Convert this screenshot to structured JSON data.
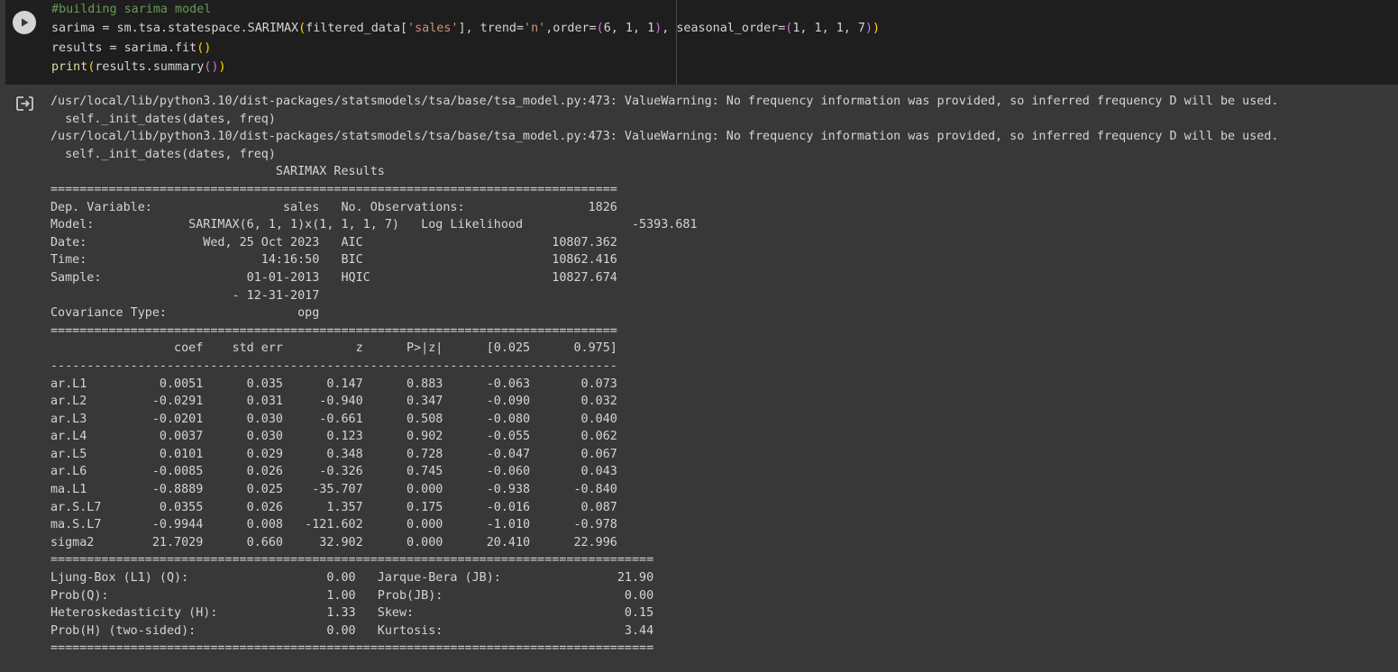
{
  "cell": {
    "run_icon": "play-icon",
    "code": {
      "line1": "#building sarima model",
      "line2_a": "sarima = sm.tsa.statespace.SARIMAX",
      "line2_b": "filtered_data[",
      "line2_c": "'sales'",
      "line2_d": "], trend=",
      "line2_e": "'n'",
      "line2_f": ",order=",
      "line2_g": "6, 1, 1",
      "line2_h": ", seasonal_order=",
      "line2_i": "1, 1, 1, 7",
      "line3": "results = sarima.fit",
      "line4_a": "print",
      "line4_b": "results.summary"
    }
  },
  "output": {
    "icon": "output-redirect-icon",
    "text": "/usr/local/lib/python3.10/dist-packages/statsmodels/tsa/base/tsa_model.py:473: ValueWarning: No frequency information was provided, so inferred frequency D will be used.\n  self._init_dates(dates, freq)\n/usr/local/lib/python3.10/dist-packages/statsmodels/tsa/base/tsa_model.py:473: ValueWarning: No frequency information was provided, so inferred frequency D will be used.\n  self._init_dates(dates, freq)\n                               SARIMAX Results                                \n==============================================================================\nDep. Variable:                  sales   No. Observations:                 1826\nModel:             SARIMAX(6, 1, 1)x(1, 1, 1, 7)   Log Likelihood               -5393.681\nDate:                Wed, 25 Oct 2023   AIC                          10807.362\nTime:                        14:16:50   BIC                          10862.416\nSample:                    01-01-2013   HQIC                         10827.674\n                         - 12-31-2017                                         \nCovariance Type:                  opg                                         \n==============================================================================\n                 coef    std err          z      P>|z|      [0.025      0.975]\n------------------------------------------------------------------------------\nar.L1          0.0051      0.035      0.147      0.883      -0.063       0.073\nar.L2         -0.0291      0.031     -0.940      0.347      -0.090       0.032\nar.L3         -0.0201      0.030     -0.661      0.508      -0.080       0.040\nar.L4          0.0037      0.030      0.123      0.902      -0.055       0.062\nar.L5          0.0101      0.029      0.348      0.728      -0.047       0.067\nar.L6         -0.0085      0.026     -0.326      0.745      -0.060       0.043\nma.L1         -0.8889      0.025    -35.707      0.000      -0.938      -0.840\nar.S.L7        0.0355      0.026      1.357      0.175      -0.016       0.087\nma.S.L7       -0.9944      0.008   -121.602      0.000      -1.010      -0.978\nsigma2        21.7029      0.660     32.902      0.000      20.410      22.996\n===================================================================================\nLjung-Box (L1) (Q):                   0.00   Jarque-Bera (JB):                21.90\nProb(Q):                              1.00   Prob(JB):                         0.00\nHeteroskedasticity (H):               1.33   Skew:                             0.15\nProb(H) (two-sided):                  0.00   Kurtosis:                         3.44\n==================================================================================="
  }
}
